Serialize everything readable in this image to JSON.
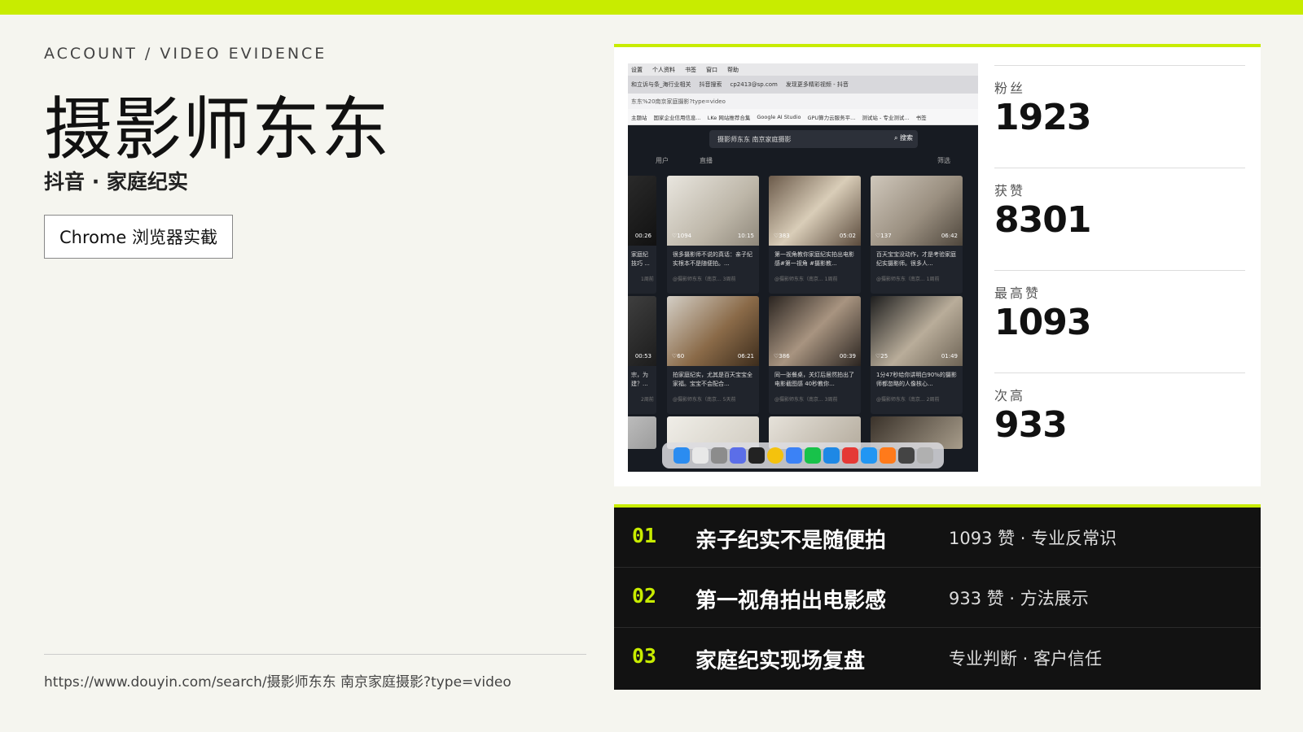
{
  "header": {
    "eyebrow": "ACCOUNT / VIDEO EVIDENCE",
    "title": "摄影师东东",
    "subtitle": "抖音 · 家庭纪实",
    "chip": "Chrome 浏览器实截"
  },
  "footer": {
    "url": "https://www.douyin.com/search/摄影师东东 南京家庭摄影?type=video"
  },
  "screenshot": {
    "menubar": [
      "设置",
      "个人资料",
      "书签",
      "窗口",
      "帮助"
    ],
    "tabs": [
      "和立诉与条_海行业相关",
      "抖音搜索",
      "cp2413@sp.com",
      "发现更多精彩视频 - 抖音"
    ],
    "address": "东东%20南京家庭摄影?type=video",
    "bookmarks": [
      "主题站",
      "国家企业信用信息...",
      "LKe 网站推荐合集",
      "Google AI Studio",
      "GPU算力云服务平...",
      "测试站 - 专业测试...",
      "书签"
    ],
    "search_text": "摄影师东东 南京家庭摄影",
    "search_button": "搜索",
    "filters": [
      "用户",
      "直播",
      "筛选"
    ],
    "tiles": [
      {
        "likes": "",
        "duration": "00:26",
        "caption": "家庭纪 技巧 ...",
        "meta": "1周前"
      },
      {
        "likes": "1094",
        "duration": "10:15",
        "caption": "很多摄影师不说的真话：亲子纪实根本不是随便拍。...",
        "meta": "@摄影师东东（南京... 3周前"
      },
      {
        "likes": "383",
        "duration": "05:02",
        "caption": "第一视角教你家庭纪实拍出电影感#第一视角 #摄影教...",
        "meta": "@摄影师东东（南京... 1周前"
      },
      {
        "likes": "137",
        "duration": "06:42",
        "caption": "百天宝宝没动作，才是考验家庭纪实摄影师。很多人...",
        "meta": "@摄影师东东（南京... 1周前"
      },
      {
        "likes": "",
        "duration": "00:53",
        "caption": "宗，为 建？...",
        "meta": "2周前"
      },
      {
        "likes": "60",
        "duration": "06:21",
        "caption": "拍家庭纪实，尤其是百天宝宝全家福。宝宝不会配合...",
        "meta": "@摄影师东东（南京... 5天前"
      },
      {
        "likes": "386",
        "duration": "00:39",
        "caption": "同一张餐桌，关灯后居然拍出了电影截图感 40秒教你...",
        "meta": "@摄影师东东（南京... 3周前"
      },
      {
        "likes": "25",
        "duration": "01:49",
        "caption": "1分47秒给你讲明白90%的摄影师都忽略的人像核心...",
        "meta": "@摄影师东东（南京... 2周前"
      }
    ]
  },
  "stats": [
    {
      "label": "粉丝",
      "value": "1923"
    },
    {
      "label": "获赞",
      "value": "8301"
    },
    {
      "label": "最高赞",
      "value": "1093"
    },
    {
      "label": "次高",
      "value": "933"
    }
  ],
  "videos": [
    {
      "num": "01",
      "name": "亲子纪实不是随便拍",
      "note": "1093 赞 · 专业反常识"
    },
    {
      "num": "02",
      "name": "第一视角拍出电影感",
      "note": "933 赞 · 方法展示"
    },
    {
      "num": "03",
      "name": "家庭纪实现场复盘",
      "note": "专业判断 · 客户信任"
    }
  ],
  "colors": {
    "accent": "#c8ec00",
    "panel_dark": "#121212",
    "background": "#f5f5ef"
  }
}
